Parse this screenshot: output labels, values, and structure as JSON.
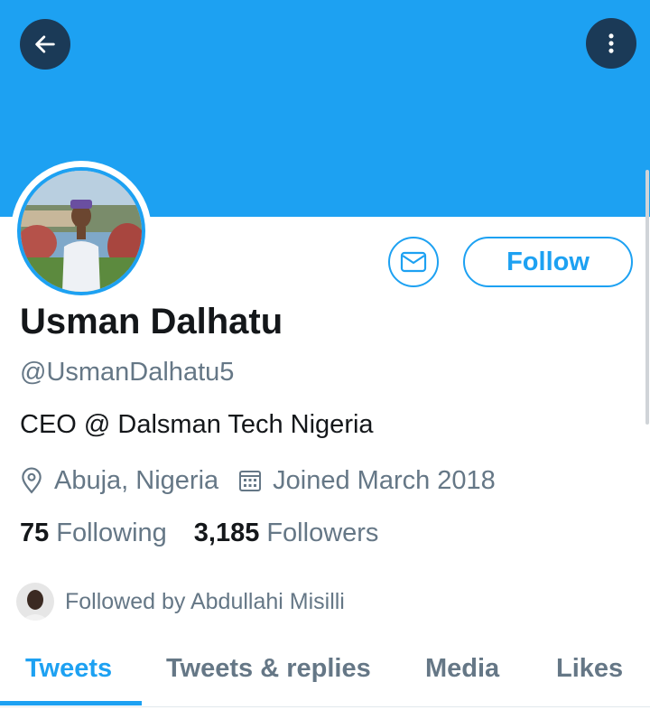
{
  "header": {
    "back_icon": "arrow-left-icon",
    "more_icon": "more-vertical-icon",
    "banner_color": "#1da1f2"
  },
  "profile": {
    "name": "Usman Dalhatu",
    "handle": "@UsmanDalhatu5",
    "bio": "CEO @ Dalsman Tech Nigeria",
    "location": "Abuja, Nigeria",
    "joined": "Joined March 2018",
    "following_count": "75",
    "following_label": "Following",
    "followers_count": "3,185",
    "followers_label": "Followers",
    "followed_by": "Followed by Abdullahi Misilli"
  },
  "actions": {
    "message_icon": "mail-icon",
    "follow_label": "Follow"
  },
  "tabs": [
    {
      "label": "Tweets",
      "active": true
    },
    {
      "label": "Tweets & replies",
      "active": false
    },
    {
      "label": "Media",
      "active": false
    },
    {
      "label": "Likes",
      "active": false
    }
  ],
  "colors": {
    "accent": "#1da1f2",
    "text_primary": "#14171a",
    "text_secondary": "#657786"
  }
}
